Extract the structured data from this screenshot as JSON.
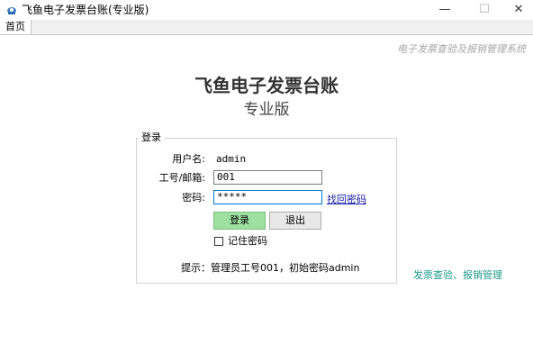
{
  "window": {
    "title": "飞鱼电子发票台账(专业版)",
    "min_glyph": "—",
    "max_glyph": "☐",
    "close_glyph": "✕"
  },
  "menubar": {
    "home_tab": "首页"
  },
  "main": {
    "brand_text": "电子发票查验及报销管理系统",
    "title": "飞鱼电子发票台账",
    "subtitle": "专业版"
  },
  "login": {
    "legend": "登录",
    "username_label": "用户名:",
    "username_value": "admin",
    "employee_label": "工号/邮箱:",
    "employee_value": "001",
    "password_label": "密码:",
    "password_value": "*****",
    "forgot_link": "找回密码",
    "login_button": "登录",
    "exit_button": "退出",
    "remember_label": "记住密码",
    "hint": "提示：管理员工号001，初始密码admin"
  },
  "side_link": "发票查验、报销管理",
  "colors": {
    "primary_button": "#9de0a0",
    "link": "#1a1aa6",
    "side_link": "#1e9a8a"
  }
}
